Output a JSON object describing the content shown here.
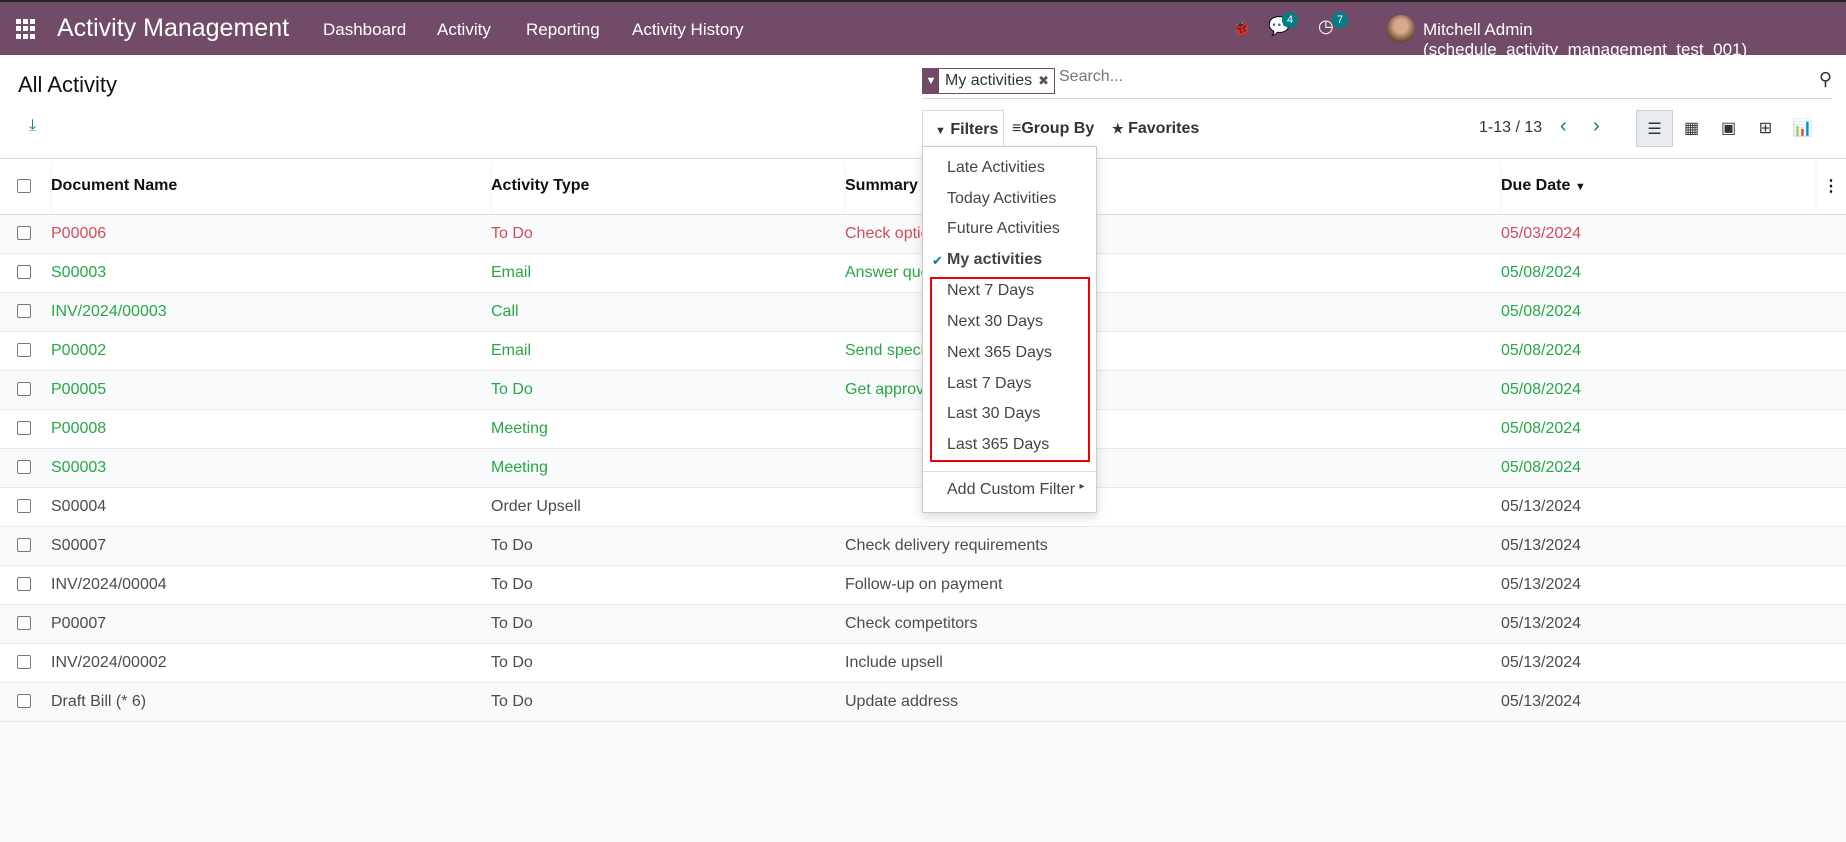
{
  "navbar": {
    "app_title": "Activity Management",
    "menus": [
      "Dashboard",
      "Activity",
      "Reporting",
      "Activity History"
    ],
    "messages_count": "4",
    "activities_count": "7",
    "user": "Mitchell Admin (schedule_activity_management_test_001)"
  },
  "control_panel": {
    "title": "All Activity",
    "facet": "My activities",
    "search_placeholder": "Search...",
    "filters": "Filters",
    "group_by": "Group By",
    "favorites": "Favorites",
    "pager": "1-13 / 13"
  },
  "filters_menu": {
    "items": [
      "Late Activities",
      "Today Activities",
      "Future Activities",
      "My activities",
      "Next 7 Days",
      "Next 30 Days",
      "Next 365 Days",
      "Last 7 Days",
      "Last 30 Days",
      "Last 365 Days"
    ],
    "checked": "My activities",
    "custom": "Add Custom Filter"
  },
  "table": {
    "headers": [
      "Document Name",
      "Activity Type",
      "Summary",
      "Due Date"
    ],
    "rows": [
      {
        "doc": "P00006",
        "type": "To Do",
        "summary": "Check optio",
        "due": "05/03/2024",
        "status": "overdue"
      },
      {
        "doc": "S00003",
        "type": "Email",
        "summary": "Answer que",
        "due": "05/08/2024",
        "status": "future"
      },
      {
        "doc": "INV/2024/00003",
        "type": "Call",
        "summary": "",
        "due": "05/08/2024",
        "status": "future"
      },
      {
        "doc": "P00002",
        "type": "Email",
        "summary": "Send speci",
        "due": "05/08/2024",
        "status": "future"
      },
      {
        "doc": "P00005",
        "type": "To Do",
        "summary": "Get approva",
        "due": "05/08/2024",
        "status": "future"
      },
      {
        "doc": "P00008",
        "type": "Meeting",
        "summary": "",
        "due": "05/08/2024",
        "status": "future"
      },
      {
        "doc": "S00003",
        "type": "Meeting",
        "summary": "",
        "due": "05/08/2024",
        "status": "future"
      },
      {
        "doc": "S00004",
        "type": "Order Upsell",
        "summary": "",
        "due": "05/13/2024",
        "status": "normal"
      },
      {
        "doc": "S00007",
        "type": "To Do",
        "summary": "Check delivery requirements",
        "due": "05/13/2024",
        "status": "normal"
      },
      {
        "doc": "INV/2024/00004",
        "type": "To Do",
        "summary": "Follow-up on payment",
        "due": "05/13/2024",
        "status": "normal"
      },
      {
        "doc": "P00007",
        "type": "To Do",
        "summary": "Check competitors",
        "due": "05/13/2024",
        "status": "normal"
      },
      {
        "doc": "INV/2024/00002",
        "type": "To Do",
        "summary": "Include upsell",
        "due": "05/13/2024",
        "status": "normal"
      },
      {
        "doc": "Draft Bill (* 6)",
        "type": "To Do",
        "summary": "Update address",
        "due": "05/13/2024",
        "status": "normal"
      }
    ]
  },
  "colors": {
    "brand": "#714b67",
    "accent": "#017e84",
    "overdue": "#d44c59",
    "future": "#28a745",
    "highlight_box": "#ee0000"
  }
}
